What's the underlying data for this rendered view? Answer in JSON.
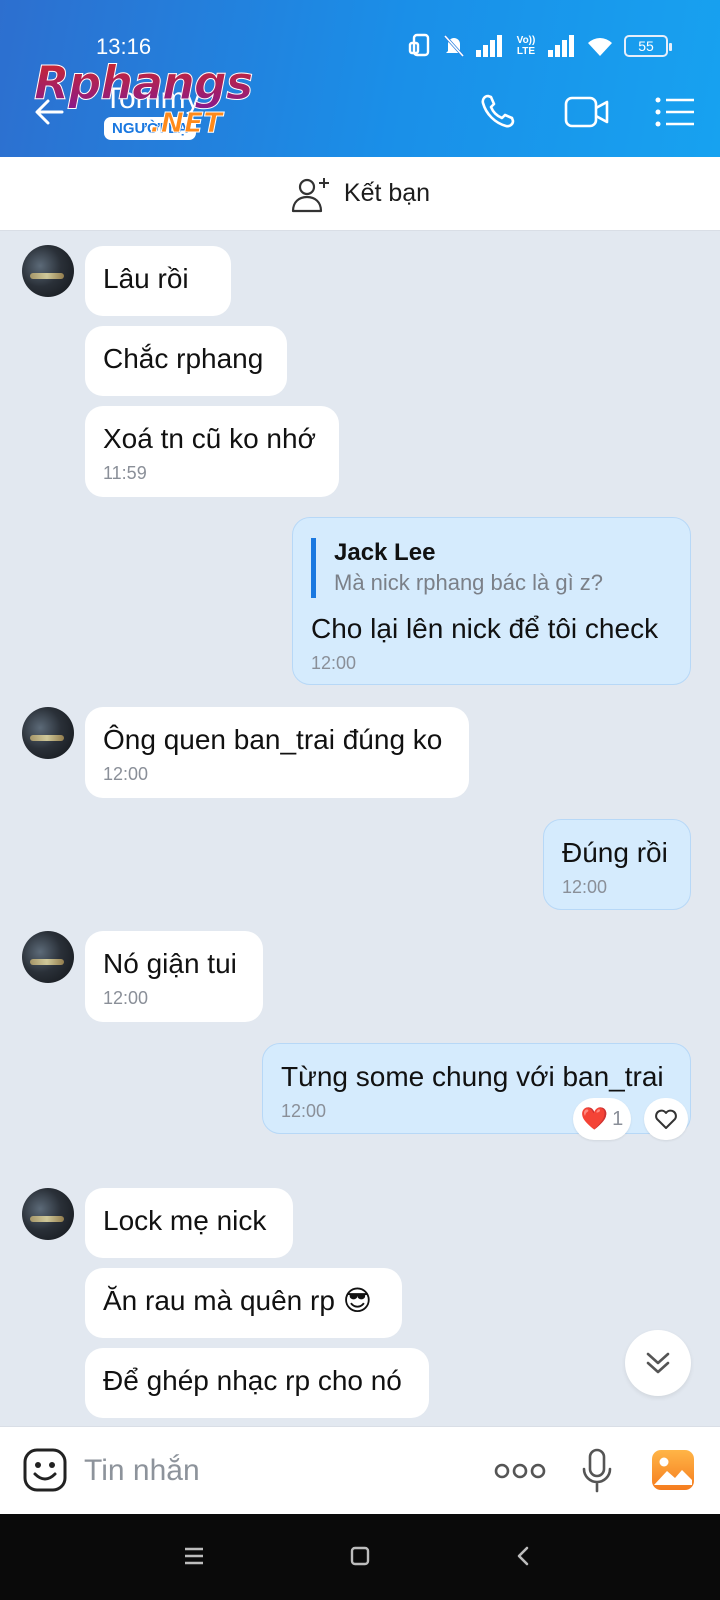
{
  "status_bar": {
    "time": "13:16",
    "battery": "55",
    "network_label": "Vo)) LTE"
  },
  "header": {
    "contact_name": "Tommy",
    "contact_badge": "NGƯỜI LẠ",
    "watermark_main": "Rphangs",
    "watermark_sub": ".NET"
  },
  "add_friend": {
    "label": "Kết bạn"
  },
  "messages": [
    {
      "text": "Lâu rồi"
    },
    {
      "text": "Chắc rphang"
    },
    {
      "text": "Xoá tn cũ ko nhớ",
      "time": "11:59"
    },
    {
      "text": "Cho lại lên nick để tôi check",
      "time": "12:00",
      "quote_author": "Jack Lee",
      "quote_text": "Mà nick rphang bác là gì z?"
    },
    {
      "text": "Ông quen ban_trai đúng ko",
      "time": "12:00"
    },
    {
      "text": "Đúng rồi",
      "time": "12:00"
    },
    {
      "text": "Nó giận tui",
      "time": "12:00"
    },
    {
      "text": "Từng some chung với ban_trai",
      "time": "12:00"
    },
    {
      "text": "Lock mẹ nick"
    },
    {
      "text": "Ăn rau mà quên rp 😎"
    },
    {
      "text": "Để ghép nhạc rp cho nó"
    }
  ],
  "reaction": {
    "emoji": "❤️",
    "count": "1"
  },
  "input": {
    "placeholder": "Tin nhắn"
  }
}
